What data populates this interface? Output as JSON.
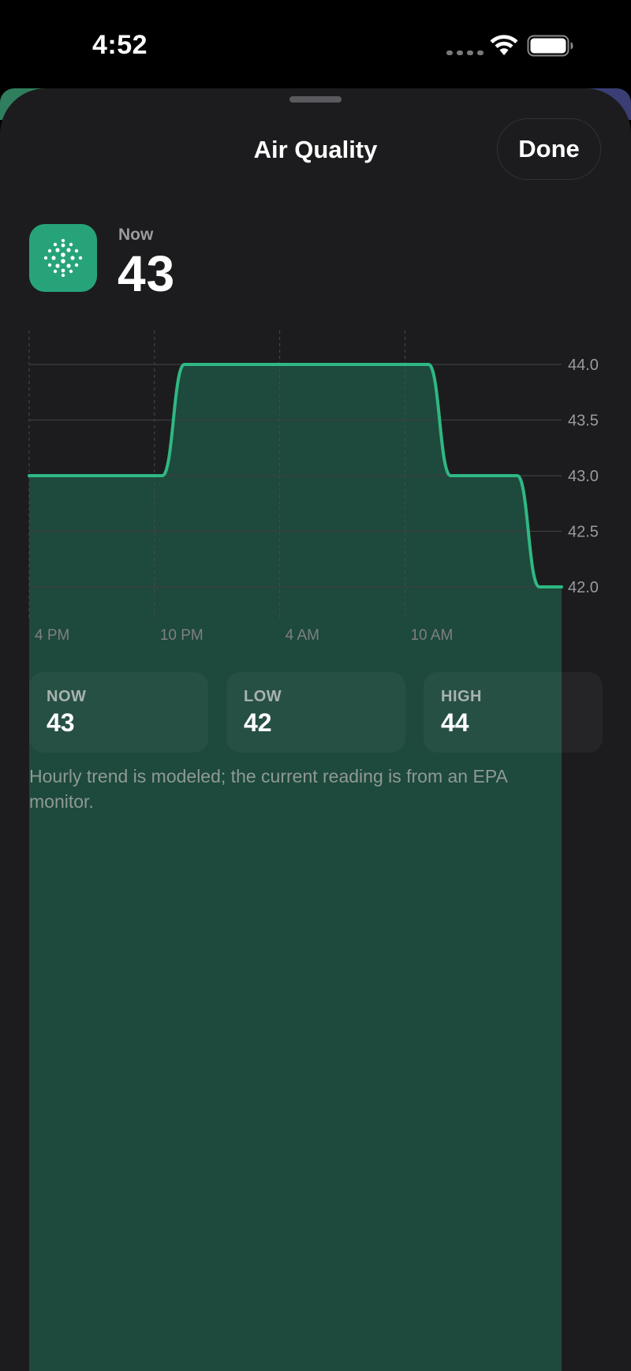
{
  "status_bar": {
    "time": "4:52"
  },
  "sheet": {
    "title": "Air Quality",
    "done_label": "Done"
  },
  "current": {
    "label": "Now",
    "value": "43"
  },
  "chart_data": {
    "type": "line",
    "x_tick_labels": [
      "4 PM",
      "10 PM",
      "4 AM",
      "10 AM"
    ],
    "y_ticks": [
      44.0,
      43.5,
      43.0,
      42.5,
      42.0
    ],
    "y_tick_labels": [
      "44.0",
      "43.5",
      "43.0",
      "42.5",
      "42.0"
    ],
    "ylim": [
      42.0,
      44.0
    ],
    "series": [
      {
        "values": [
          43,
          43,
          43,
          43,
          43,
          43,
          43,
          44,
          44,
          44,
          44,
          44,
          44,
          44,
          44,
          44,
          44,
          44,
          44,
          43,
          43,
          43,
          43,
          42,
          42
        ]
      }
    ],
    "line_color": "#2fb884",
    "fill_color": "#1e4d40",
    "grid": true
  },
  "stats": [
    {
      "label": "NOW",
      "value": "43"
    },
    {
      "label": "LOW",
      "value": "42"
    },
    {
      "label": "HIGH",
      "value": "44"
    }
  ],
  "footnote": "Hourly trend is modeled; the current reading is from an EPA monitor.",
  "colors": {
    "accent": "#27a37a",
    "sheet_bg": "#1c1c1e",
    "fill": "#1e4d40"
  },
  "icons": {
    "app": "air-quality-dots-icon",
    "wifi": "wifi-icon",
    "battery": "battery-icon"
  }
}
